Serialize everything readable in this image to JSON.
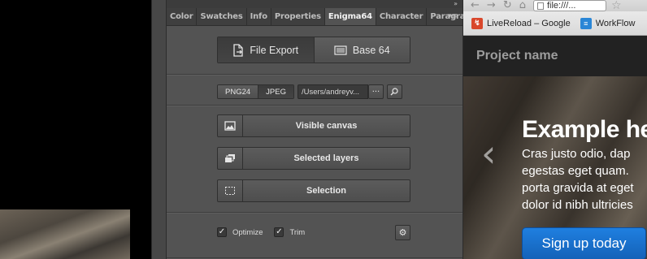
{
  "panel": {
    "tabs": [
      {
        "label": "Color"
      },
      {
        "label": "Swatches"
      },
      {
        "label": "Info"
      },
      {
        "label": "Properties"
      },
      {
        "label": "Enigma64"
      },
      {
        "label": "Character"
      },
      {
        "label": "Paragrap"
      }
    ],
    "active_tab": "Enigma64",
    "mode": {
      "file_export_label": "File Export",
      "base64_label": "Base 64",
      "active": "File Export"
    },
    "format": {
      "png_label": "PNG24",
      "jpeg_label": "JPEG",
      "active": "JPEG",
      "path_value": "/Users/andreyv...",
      "browse_label": "···"
    },
    "exports": {
      "visible_canvas_label": "Visible canvas",
      "selected_layers_label": "Selected layers",
      "selection_label": "Selection"
    },
    "options": {
      "optimize_label": "Optimize",
      "optimize_checked": true,
      "trim_label": "Trim",
      "trim_checked": true
    }
  },
  "browser": {
    "url": "file:///...",
    "bookmarks": [
      {
        "label": "LiveReload – Google",
        "icon": "livereload-icon",
        "color": "#d9472b"
      },
      {
        "label": "WorkFlow",
        "icon": "workflowy-icon",
        "color": "#2a86d6"
      }
    ],
    "site": {
      "project_name": "Project name",
      "hero_title": "Example he",
      "hero_lines": [
        "Cras justo odio, dap",
        "egestas eget quam.",
        "porta gravida at eget",
        "dolor id nibh ultricies"
      ],
      "signup_label": "Sign up today"
    }
  },
  "colors": {
    "panel_bg": "#535353",
    "signup_blue": "#1f7fe0",
    "site_navbar": "#222222"
  }
}
